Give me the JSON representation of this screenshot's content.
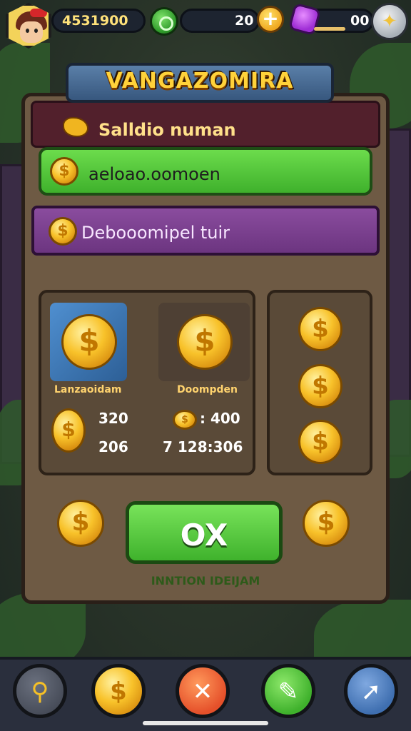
{
  "topbar": {
    "currency_amount": "4531900",
    "gems_amount": "20",
    "energy_amount": "00"
  },
  "banner": {
    "title": "VANGAZOMIRA"
  },
  "panel": {
    "header_label": "Salldio numan",
    "option_green": "aeloao.oomoen",
    "option_purple": "Debooomipel tuir"
  },
  "cards": {
    "left_label": "Lanzaoidam",
    "middle_label": "Doompden",
    "left_value_1": "320",
    "left_value_2": "206",
    "middle_value_1": ": 400",
    "middle_value_2": "7 128:306"
  },
  "actions": {
    "ok_label": "OX",
    "footer_note": "INNTION IDEIJAM"
  },
  "icons": {
    "coin": "dollar-coin-icon",
    "gem": "gem-icon",
    "potion": "potion-icon",
    "settings": "settings-icon",
    "search": "search-icon",
    "close": "close-icon",
    "edit": "pencil-icon",
    "share": "arrow-icon"
  },
  "colors": {
    "accent_gold": "#f8c22a",
    "accent_green": "#3fb12c",
    "accent_purple": "#6c3580",
    "accent_red": "#e5502a",
    "accent_blue": "#3f6fb0"
  }
}
